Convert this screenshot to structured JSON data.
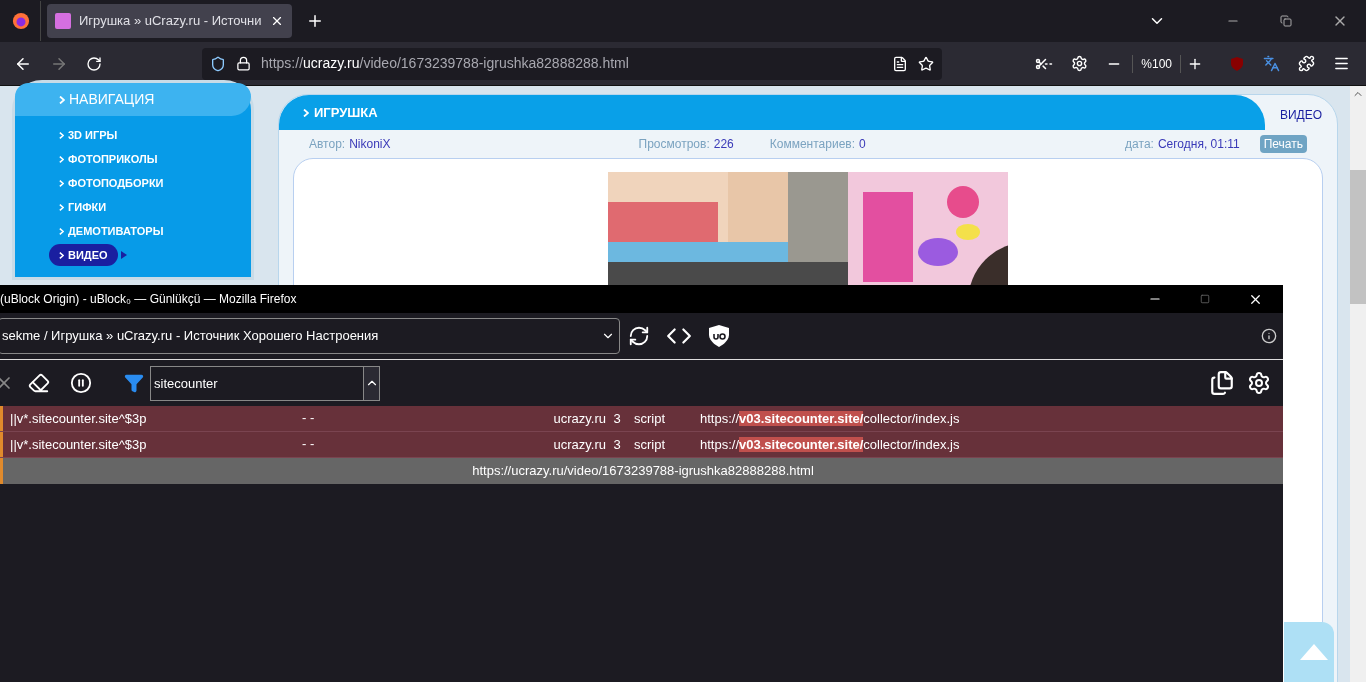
{
  "browser": {
    "tab_title": "Игрушка » uCrazy.ru - Источни",
    "address": "https://**ucrazy.ru**/video/1673239788-igrushka82888288.html",
    "zoom": "%100"
  },
  "sidebar": {
    "title": "НАВИГАЦИЯ",
    "items": [
      {
        "label": "3D ИГРЫ",
        "selected": false
      },
      {
        "label": "ФОТОПРИКОЛЫ",
        "selected": false
      },
      {
        "label": "ФОТОПОДБОРКИ",
        "selected": false
      },
      {
        "label": "ГИФКИ",
        "selected": false
      },
      {
        "label": "ДЕМОТИВАТОРЫ",
        "selected": false
      },
      {
        "label": "ВИДЕО",
        "selected": true
      }
    ]
  },
  "article": {
    "title": "ИГРУШКА",
    "category": "ВИДЕО",
    "author_label": "Автор:",
    "author": "NikoniX",
    "views_label": "Просмотров:",
    "views": "226",
    "comments_label": "Комментариев:",
    "comments": "0",
    "date_label": "дата:",
    "date": "Сегодня, 01:11",
    "print_button": "Печать"
  },
  "logger": {
    "window_title": "(uBlock Origin) - uBlock₀ — Günlükçü — Mozilla Firefox",
    "tab_select": "sekme / Игрушка » uCrazy.ru - Источник Хорошего Настроения",
    "filter": "sitecounter",
    "rows": [
      {
        "kind": "blocked",
        "filter": "||v*.sitecounter.site^$3p",
        "column_2": "- -",
        "domain": "ucrazy.ru",
        "count": "3",
        "type": "script",
        "url": "https://**v03.sitecounter.site/**collector/index.js"
      },
      {
        "kind": "blocked",
        "filter": "||v*.sitecounter.site^$3p",
        "column_2": "- -",
        "domain": "ucrazy.ru",
        "count": "3",
        "type": "script",
        "url": "https://**v03.sitecounter.site/**collector/index.js"
      },
      {
        "kind": "page",
        "url": "https://ucrazy.ru/video/1673239788-igrushka82888288.html"
      }
    ]
  }
}
